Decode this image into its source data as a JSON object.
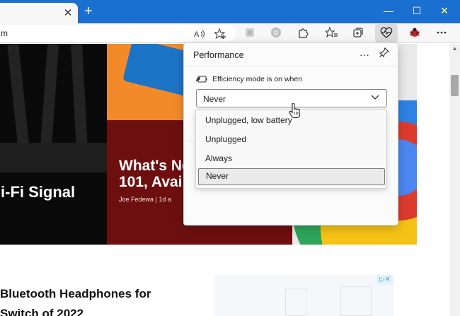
{
  "browser": {
    "tab_close_glyph": "✕",
    "new_tab_glyph": "+",
    "window_controls": {
      "minimize": "—",
      "maximize": "☐",
      "close": "✕"
    },
    "address_text": "m",
    "toolbar_icons": [
      "read-aloud-icon",
      "add-favorite-icon",
      "extension-icon",
      "google-icon",
      "extensions-puzzle-icon",
      "favorites-icon",
      "collections-icon",
      "performance-heart-icon",
      "ladybug-extension-icon",
      "settings-more-icon"
    ],
    "accent_color": "#1b6fd0"
  },
  "page": {
    "hero_left_title": "i-Fi Signal",
    "hero_mid_title": "What's Ne\n101, Avai",
    "hero_mid_byline": "Joe Fedewa   |   1d a",
    "article_title": "Bluetooth Headphones for\nSwitch of 2022",
    "ad_badge": "▷✕"
  },
  "performance": {
    "title": "Performance",
    "more_glyph": "···",
    "efficiency_label": "Efficiency mode is on when",
    "select_value": "Never",
    "options": [
      {
        "label": "Unplugged, low battery",
        "selected": false
      },
      {
        "label": "Unplugged",
        "selected": false
      },
      {
        "label": "Always",
        "selected": false
      },
      {
        "label": "Never",
        "selected": true
      }
    ]
  }
}
